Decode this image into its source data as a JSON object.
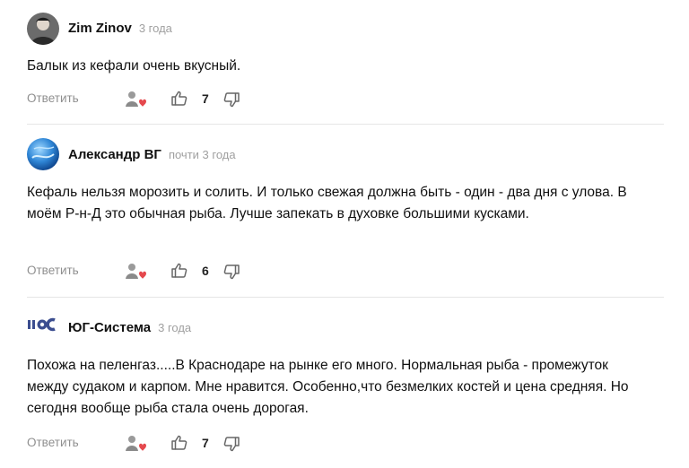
{
  "comments": [
    {
      "author": "Zim Zinov",
      "time": "3 года",
      "text": "Балык из кефали очень вкусный.",
      "reply_label": "Ответить",
      "likes": "7",
      "avatar_icon": "user-photo-avatar"
    },
    {
      "author": "Александр ВГ",
      "time": "почти 3 года",
      "text": "Кефаль нельзя морозить и солить. И только свежая должна быть - один - два дня с улова. В моём Р-н-Д это обычная рыба. Лучше запекать в духовке большими кусками.",
      "reply_label": "Ответить",
      "likes": "6",
      "avatar_icon": "globe-avatar"
    },
    {
      "author": "ЮГ-Система",
      "time": "3 года",
      "text": "Похожа на пеленгаз.....В Краснодаре на рынке его много. Нормальная рыба - промежуток между судаком и карпом. Мне нравится. Особенно,что безмелких костей и цена средняя. Но сегодня вообще рыба стала очень дорогая.",
      "reply_label": "Ответить",
      "likes": "7",
      "avatar_icon": "brand-logo-avatar"
    }
  ]
}
